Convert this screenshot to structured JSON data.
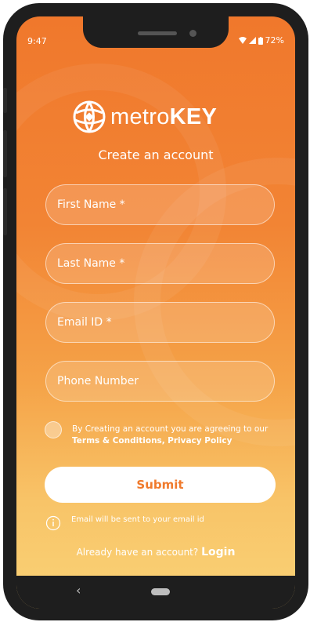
{
  "status_bar": {
    "time": "9:47",
    "battery": "72%"
  },
  "brand": {
    "name_light": "metro",
    "name_bold": "KEY"
  },
  "form": {
    "heading": "Create an account",
    "first_name_placeholder": "First Name *",
    "last_name_placeholder": "Last Name *",
    "email_placeholder": "Email ID *",
    "phone_placeholder": "Phone Number",
    "agree_text": "By Creating an account you are agreeing to our",
    "terms_link": "Terms & Conditions,",
    "privacy_link": "Privacy Policy",
    "agree_checked": false,
    "submit_label": "Submit",
    "info_note": "Email will be sent to your email id",
    "login_prompt": "Already have an account?",
    "login_link": "Login"
  },
  "nav": {
    "back_glyph": "‹"
  },
  "colors": {
    "accent": "#f07a2c",
    "gradient_bottom": "#fad276"
  }
}
